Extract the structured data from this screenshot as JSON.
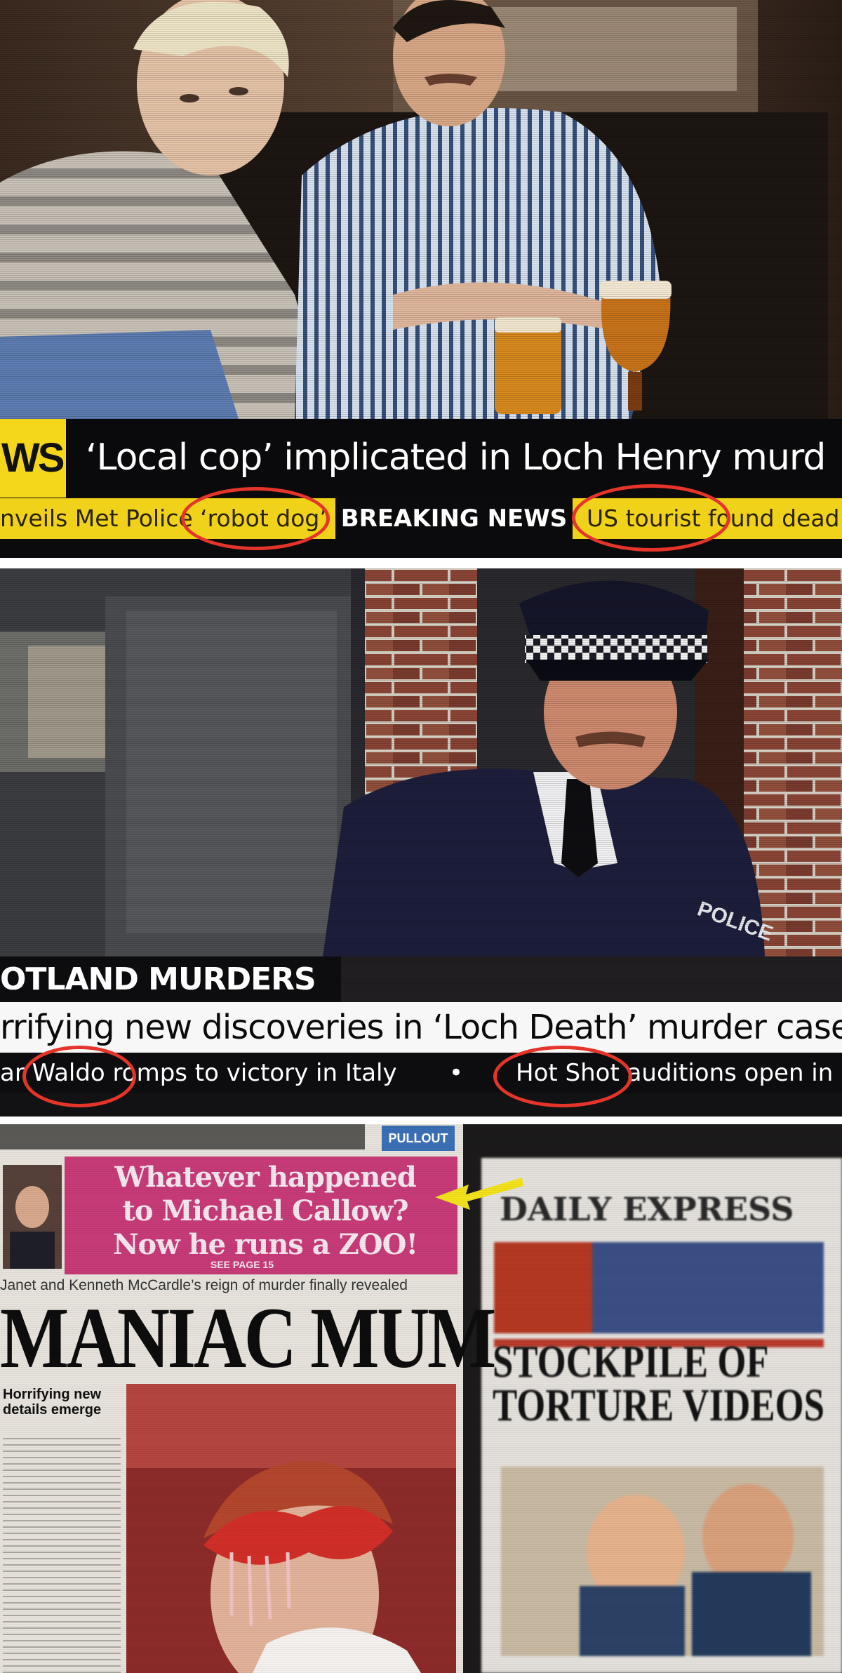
{
  "panel1": {
    "show_tag": "WS",
    "headline": "‘Local cop’ implicated in Loch Henry murd",
    "ticker_left": "nveils Met Police ‘robot dog’",
    "ticker_center": "BREAKING NEWS",
    "ticker_right": "US tourist found dead"
  },
  "panel2": {
    "section_tag": "OTLAND MURDERS",
    "headline": "rrifying new discoveries in ‘Loch Death’ murder case",
    "ticker_left": "ar Waldo romps to victory in Italy",
    "ticker_dot": "•",
    "ticker_right": "Hot Shot auditions open in"
  },
  "panel3": {
    "paper1": {
      "pullout_badge": "PULLOUT",
      "teaser_line1": "Whatever happened",
      "teaser_line2": "to Michael Callow?",
      "teaser_line3": "Now he runs a ZOO!",
      "teaser_page": "SEE PAGE 15",
      "strapline": "Janet and Kenneth McCardle’s reign of murder finally revealed",
      "headline": "MANIAC MUM",
      "subhead": "Horrifying new details emerge"
    },
    "paper2": {
      "masthead": "DAILY EXPRESS",
      "headline_line1": "STOCKPILE OF",
      "headline_line2": "TORTURE VIDEOS"
    }
  },
  "colors": {
    "ticker_yellow": "#f0d21a",
    "annotation_red": "#e5342a",
    "arrow_yellow": "#f3e21b",
    "teaser_pink": "#c73b78"
  }
}
